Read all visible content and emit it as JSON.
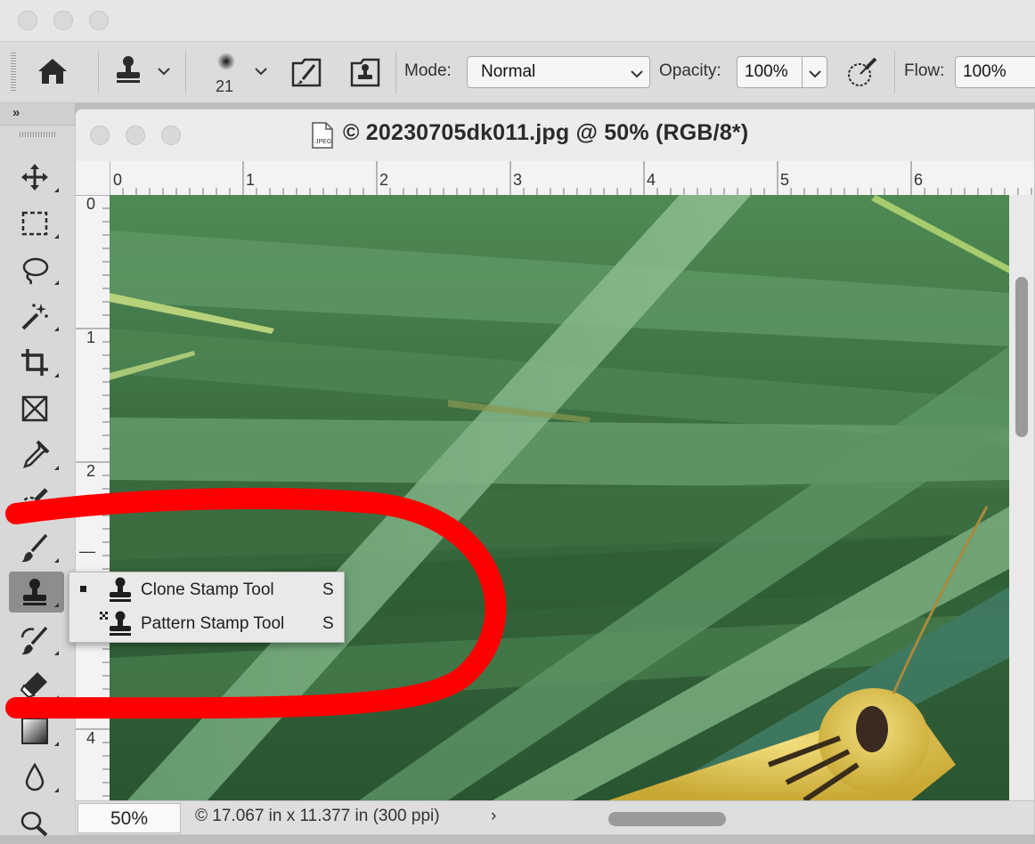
{
  "window": {
    "close": "close",
    "minimize": "minimize",
    "zoom": "zoom"
  },
  "options_bar": {
    "brush_size": "21",
    "mode_label": "Mode:",
    "mode_value": "Normal",
    "opacity_label": "Opacity:",
    "opacity_value": "100%",
    "flow_label": "Flow:",
    "flow_value": "100%"
  },
  "toolbar": {
    "expand": "»",
    "tools": [
      "move",
      "marquee",
      "lasso",
      "magic-wand",
      "crop",
      "frame",
      "eyedropper",
      "spot-healing",
      "brush",
      "clone-stamp",
      "history-brush",
      "eraser",
      "gradient",
      "blur",
      "dodge"
    ]
  },
  "document": {
    "title": "© 20230705dk011.jpg @ 50% (RGB/8*)",
    "ruler_top": [
      "0",
      "1",
      "2",
      "3",
      "4",
      "5",
      "6"
    ],
    "ruler_left": [
      "0",
      "1",
      "2",
      "—",
      "4"
    ],
    "zoom": "50%",
    "info": "© 17.067 in x 11.377 in (300 ppi)",
    "info_chevron": "›"
  },
  "flyout": {
    "items": [
      {
        "label": "Clone Stamp Tool",
        "key": "S",
        "selected": true
      },
      {
        "label": "Pattern Stamp Tool",
        "key": "S",
        "selected": false
      }
    ]
  },
  "colors": {
    "annotation": "#ff0000",
    "grass_dark": "#2e5a30",
    "grass_light": "#7fb07a",
    "grasshopper": "#e0c85a"
  }
}
